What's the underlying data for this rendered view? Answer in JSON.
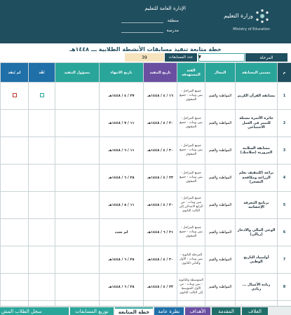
{
  "header": {
    "ministry_name": "وزارة التعليم",
    "ministry_sub": "Ministry of Education",
    "admin_title": "الإدارة العامة للتعليم",
    "region_label": "منطقة",
    "school_label": "مدرسة"
  },
  "doc_title": "خطة متابعة تنفيذ مسابقات الأنشطة الطلابية ـــ ١٤٤٨هـ",
  "filters": {
    "stage_label": "المرحلة",
    "stage_value": "",
    "count_label": "عدد المسابقات",
    "count_value": "39"
  },
  "table": {
    "columns": {
      "num": "م",
      "name": "مسمى المسابقة",
      "field": "المجال",
      "category": "الفئة المستهدفة",
      "start": "تاريخ التنفيذ",
      "end": "تاريخ الانتهاء",
      "owner": "مسؤول التنفيذ",
      "done": "نُفّذ",
      "notdone": "لم يُنفذ"
    },
    "rows": [
      {
        "num": "1",
        "name": "مسابقة القرآن الكريم",
        "field": "المواطنة والقيم",
        "category": "جميع المراحل - بنين وبنات - جميع الصفوف",
        "start": "١٦ / ٤ / ١٤٤٨هـ",
        "end": "٢٧ / ٤ / ١٤٤٨هـ",
        "owner": "",
        "done": "empty",
        "notdone": "empty"
      },
      {
        "num": "2",
        "name": "جائزة الأسرة مسئلة للتميز في العمل الاجتماعي",
        "field": "المواطنة والقيم",
        "category": "جميع المراحل - بنين وبنات - جميع الصفوف",
        "start": "٣٠ / ٤ / ١٤٤٨هـ",
        "end": "١١ / ٧ / ١٤٤٨هـ",
        "owner": "",
        "done": "",
        "notdone": ""
      },
      {
        "num": "3",
        "name": "مسابقة السلامة المرورية (سلامتك)",
        "field": "المواطنة والقيم",
        "category": "جميع المراحل - بنين وبنات - جميع الصفوف",
        "start": "٣٠ / ٤ / ١٤٤٨هـ",
        "end": "١١ / ٦ / ١٤٤٨هـ",
        "owner": "",
        "done": "",
        "notdone": ""
      },
      {
        "num": "4",
        "name": "براعة (للتثقيف بعلم الزراعة ومكافحة التصحر)",
        "field": "المواطنة والقيم",
        "category": "جميع المراحل - بنين وبنات - جميع الصفوف",
        "start": "٢٣ / ٤ / ١٤٤٨هـ",
        "end": "٢٨ / ٦ / ١٤٤٨هـ",
        "owner": "",
        "done": "",
        "notdone": ""
      },
      {
        "num": "5",
        "name": "برنامج المعرفة الإحصائية",
        "field": "المواطنة والقيم",
        "category": "جميع المراحل - بنين وبنات - من الرابع الابتدائي إلى الثالث الثانوي",
        "start": "٣٠ / ٤ / ١٤٤٨هـ",
        "end": "١١ / ٥ / ١٤٤٨هـ",
        "owner": "",
        "done": "",
        "notdone": ""
      },
      {
        "num": "6",
        "name": "الوعي المالي والادخار (ريالي)",
        "field": "المواطنة والقيم",
        "category": "جميع المراحل - بنين وبنات - جميع الصفوف",
        "start": "٢١ / ٦ / ١٤٤٨هـ",
        "end": "لم تحدد",
        "owner": "",
        "done": "",
        "notdone": ""
      },
      {
        "num": "7",
        "name": "أولمبياد التاريخ الوطني",
        "field": "المواطنة والقيم",
        "category": "المرحلة الثانوية - بنين وبنات - الأول والثاني الثانوي",
        "start": "٣٠ / ٤ / ١٤٤٨هـ",
        "end": "٢٥ / ٦ / ١٤٤٨هـ",
        "owner": "",
        "done": "",
        "notdone": ""
      },
      {
        "num": "8",
        "name": "ريادة الأعمال ... ريادي",
        "field": "المواطنة والقيم",
        "category": "المتوسطة والثانوية - بنين وبنات - من الأول المتوسط إلى الثالث الثانوي",
        "start": "٢٣ / ٤ / ١٤٤٨هـ",
        "end": "٢٨ / ٦ / ١٤٤٨هـ",
        "owner": "",
        "done": "",
        "notdone": ""
      },
      {
        "num": "9",
        "name": "",
        "field": "",
        "category": "",
        "start": "",
        "end": "",
        "owner": "",
        "done": "",
        "notdone": ""
      }
    ]
  },
  "tabs": [
    {
      "label": "الغلاف",
      "color": "#1f6e6a"
    },
    {
      "label": "المقدمة",
      "color": "#1f6e6a"
    },
    {
      "label": "الأهداف",
      "color": "#6a4fa1"
    },
    {
      "label": "نظرة عامة",
      "color": "#1f6fa8"
    },
    {
      "label": "خطة المتابعة",
      "color": "#ffffff",
      "active": true
    },
    {
      "label": "توزيع المسابقات",
      "color": "#2aa59a"
    },
    {
      "label": "سجل الطلاب المش",
      "color": "#2aa59a"
    }
  ],
  "colors": {
    "header_bg": "#1f4e5e",
    "teal": "#2aa59a",
    "purple": "#6a4fa1",
    "blue": "#1f6fa8",
    "count_bg": "#f6e4bf"
  }
}
